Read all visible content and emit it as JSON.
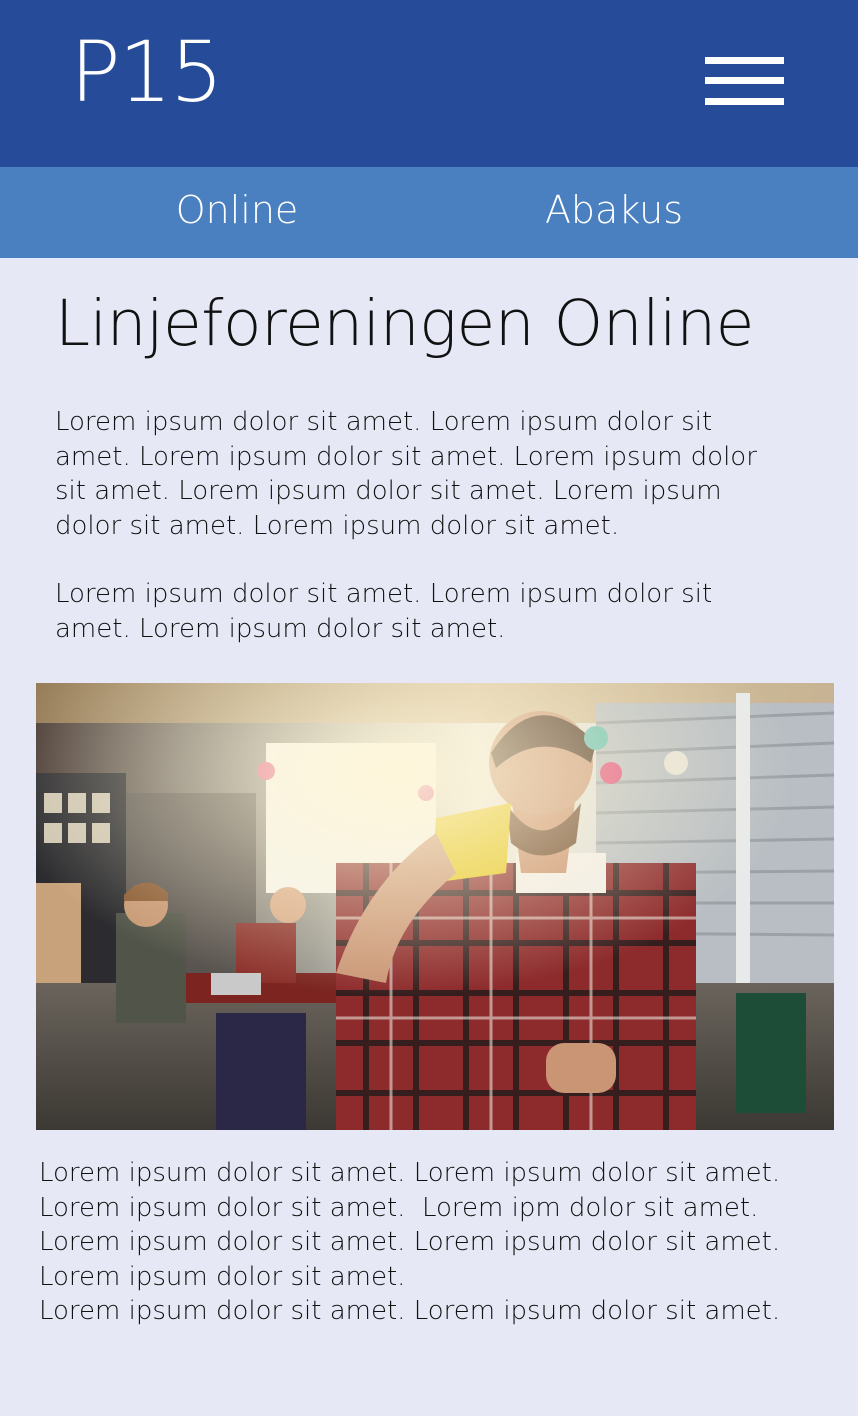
{
  "header": {
    "logo": "P15",
    "menu_icon": "hamburger-menu-icon",
    "background_color": "#264c99"
  },
  "tabs": {
    "background_color": "#4a7fc0",
    "items": [
      {
        "label": "Online"
      },
      {
        "label": "Abakus"
      }
    ]
  },
  "main": {
    "title": "Linjeforeningen Online",
    "paragraphs": [
      "Lorem ipsum dolor sit amet. Lorem ipsum dolor sit amet. Lorem ipsum dolor sit amet. Lorem ipsum dolor sit amet. Lorem ipsum dolor sit amet. Lorem ipsum dolor sit amet. Lorem ipsum dolor sit amet.",
      "Lorem ipsum dolor sit amet. Lorem ipsum dolor sit amet. Lorem ipsum dolor sit amet."
    ],
    "caption_lines": [
      "Lorem ipsum dolor sit amet. Lorem ipsum dolor sit amet.",
      "Lorem ipsum dolor sit amet.  Lorem ipm dolor sit amet.",
      "Lorem ipsum dolor sit amet. Lorem ipsum dolor sit amet.",
      "Lorem ipsum dolor sit amet.",
      "Lorem ipsum dolor sit amet. Lorem ipsum dolor sit amet."
    ]
  },
  "page_background_color": "#e6e9f5"
}
